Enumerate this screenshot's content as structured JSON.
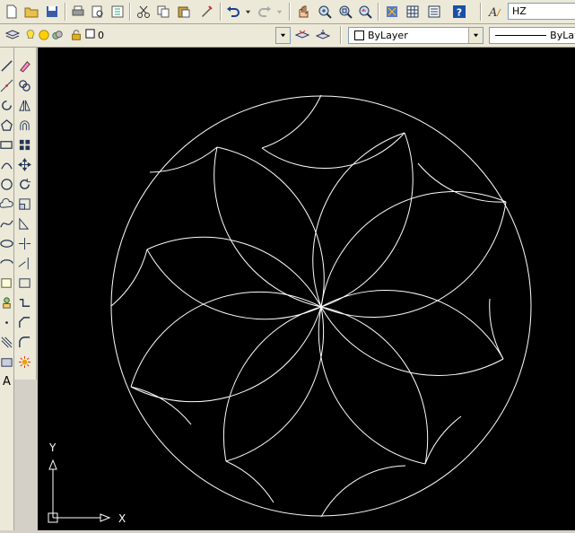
{
  "text_style": {
    "value": "HZ"
  },
  "layer": {
    "value": "0"
  },
  "color": {
    "value": "ByLayer"
  },
  "linetype": {
    "value": "ByLay"
  },
  "ucs": {
    "y_label": "Y",
    "x_label": "X"
  },
  "left_toolbar": {
    "text_tool": "A"
  },
  "colors": {
    "background": "#000000",
    "drawing_lines": "#ffffff",
    "toolbar": "#ece9d8"
  },
  "icons": [
    "new-icon",
    "open-icon",
    "save-icon",
    "print-icon",
    "plot-preview-icon",
    "publish-icon",
    "cut-icon",
    "copy-icon",
    "paste-icon",
    "match-properties-icon",
    "undo-icon",
    "redo-icon",
    "pan-icon",
    "zoom-realtime-icon",
    "zoom-window-icon",
    "zoom-previous-icon",
    "design-center-icon",
    "tool-palettes-icon",
    "help-icon",
    "text-style-icon"
  ]
}
